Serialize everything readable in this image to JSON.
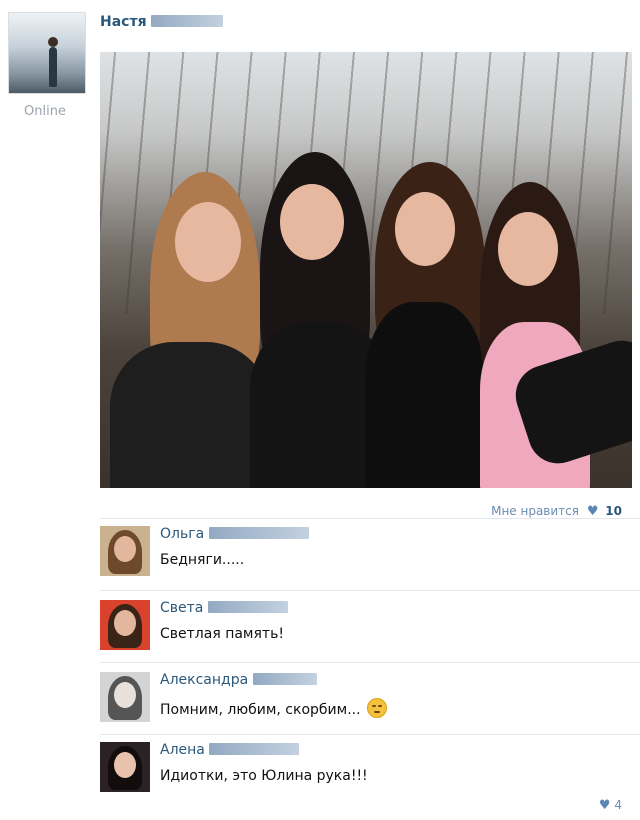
{
  "post": {
    "author_first_name": "Настя",
    "status": "Online",
    "like_label": "Мне нравится",
    "like_count": "10"
  },
  "comments": [
    {
      "name": "Ольга",
      "text": "Бедняги....."
    },
    {
      "name": "Света",
      "text": "Светлая память!"
    },
    {
      "name": "Александра",
      "text": "Помним, любим, скорбим...",
      "emoji": "sad-face-icon"
    },
    {
      "name": "Алена",
      "text": "Идиотки, это Юлина рука!!!"
    }
  ],
  "footer": {
    "like_count": "4"
  },
  "icons": {
    "like": "heart-icon"
  },
  "colors": {
    "link": "#2b587a",
    "muted": "#6b8db1",
    "status": "#9aa4ad"
  }
}
